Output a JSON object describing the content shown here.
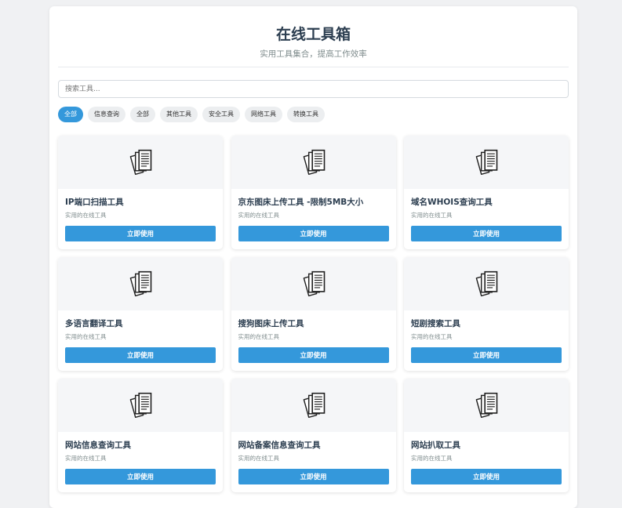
{
  "header": {
    "title": "在线工具箱",
    "subtitle": "实用工具集合，提高工作效率"
  },
  "search": {
    "placeholder": "搜索工具..."
  },
  "filters": [
    {
      "label": "全部",
      "active": true
    },
    {
      "label": "信息查询",
      "active": false
    },
    {
      "label": "全部",
      "active": false
    },
    {
      "label": "其他工具",
      "active": false
    },
    {
      "label": "安全工具",
      "active": false
    },
    {
      "label": "网络工具",
      "active": false
    },
    {
      "label": "转换工具",
      "active": false
    }
  ],
  "tools": [
    {
      "title": "IP端口扫描工具",
      "desc": "实用的在线工具",
      "button": "立即使用",
      "icon": "documents-icon"
    },
    {
      "title": "京东图床上传工具 -限制5MB大小",
      "desc": "实用的在线工具",
      "button": "立即使用",
      "icon": "documents-icon"
    },
    {
      "title": "域名WHOIS查询工具",
      "desc": "实用的在线工具",
      "button": "立即使用",
      "icon": "documents-icon"
    },
    {
      "title": "多语言翻译工具",
      "desc": "实用的在线工具",
      "button": "立即使用",
      "icon": "documents-icon"
    },
    {
      "title": "搜狗图床上传工具",
      "desc": "实用的在线工具",
      "button": "立即使用",
      "icon": "documents-icon"
    },
    {
      "title": "短剧搜索工具",
      "desc": "实用的在线工具",
      "button": "立即使用",
      "icon": "documents-icon"
    },
    {
      "title": "网站信息查询工具",
      "desc": "实用的在线工具",
      "button": "立即使用",
      "icon": "documents-icon"
    },
    {
      "title": "网站备案信息查询工具",
      "desc": "实用的在线工具",
      "button": "立即使用",
      "icon": "documents-icon"
    },
    {
      "title": "网站扒取工具",
      "desc": "实用的在线工具",
      "button": "立即使用",
      "icon": "documents-icon"
    }
  ],
  "colors": {
    "accent": "#3498db",
    "title": "#2c3e50",
    "muted": "#7f8c8d",
    "background": "#f0f1f3"
  }
}
